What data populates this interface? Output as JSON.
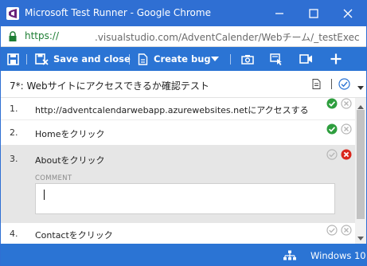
{
  "window": {
    "title": "Microsoft Test Runner - Google Chrome",
    "app_icon": "visual-studio-icon"
  },
  "address": {
    "scheme": "https://",
    "rest": ".visualstudio.com/AdventCalender/Webチーム/_testExec"
  },
  "toolbar": {
    "save_close_label": "Save and close",
    "create_bug_label": "Create bug",
    "icons": [
      "save-icon",
      "save-close-icon",
      "bug-icon",
      "chevron-down-icon",
      "camera-icon",
      "action-log-icon",
      "video-icon",
      "plus-icon"
    ]
  },
  "test_case": {
    "title": "7*: Webサイトにアクセスできるか確認テスト"
  },
  "steps": [
    {
      "number": "1.",
      "text": "http://adventcalendarwebapp.azurewebsites.netにアクセスする",
      "status": "passed"
    },
    {
      "number": "2.",
      "text": " Homeをクリック",
      "status": "passed"
    },
    {
      "number": "3.",
      "text": "Aboutをクリック",
      "status": "failed",
      "comment_label": "COMMENT",
      "comment_value": ""
    },
    {
      "number": "4.",
      "text": "Contactをクリック",
      "status": "none"
    }
  ],
  "statusbar": {
    "os_label": "Windows 10",
    "os_icon": "network-icon"
  },
  "colors": {
    "titlebar": "#2f6fd3",
    "toolbar": "#2b74d4",
    "pass": "#2e9e3e",
    "fail": "#d9261c",
    "selected_row": "#e6e6e6"
  }
}
